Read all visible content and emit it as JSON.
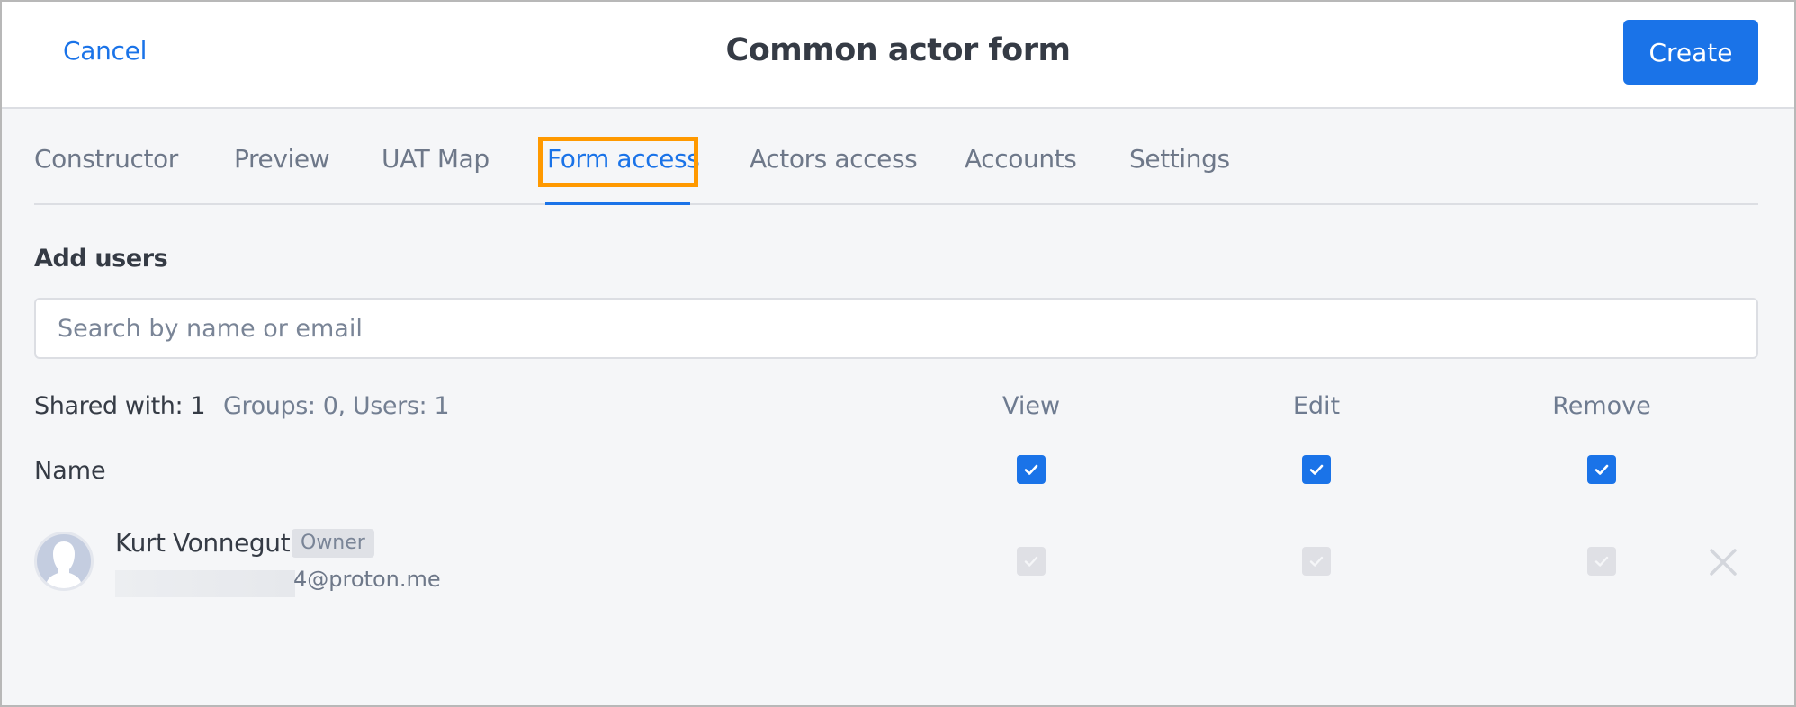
{
  "header": {
    "cancel_label": "Cancel",
    "title": "Common actor form",
    "create_label": "Create"
  },
  "tabs": [
    {
      "label": "Constructor",
      "active": false
    },
    {
      "label": "Preview",
      "active": false
    },
    {
      "label": "UAT Map",
      "active": false
    },
    {
      "label": "Form access",
      "active": true
    },
    {
      "label": "Actors access",
      "active": false
    },
    {
      "label": "Accounts",
      "active": false
    },
    {
      "label": "Settings",
      "active": false
    }
  ],
  "add_users": {
    "label": "Add users",
    "search_placeholder": "Search by name or email",
    "search_value": ""
  },
  "summary": {
    "shared_with": "Shared with: 1",
    "breakdown": "Groups: 0, Users: 1"
  },
  "columns": {
    "name": "Name",
    "view": "View",
    "edit": "Edit",
    "remove": "Remove"
  },
  "header_permissions": {
    "view": true,
    "edit": true,
    "remove": true
  },
  "users": [
    {
      "name": "Kurt Vonnegut",
      "badge": "Owner",
      "email_visible": "4@proton.me",
      "email_redacted": true,
      "permissions": {
        "view": true,
        "edit": true,
        "remove": true
      },
      "permissions_disabled": true,
      "avatar_icon": "default-user-silhouette-icon",
      "remove_icon": "close-icon"
    }
  ],
  "colors": {
    "accent": "#1a73e8",
    "focus_ring": "#ff9900",
    "text_primary": "#353b45",
    "text_secondary": "#6e7889",
    "disabled": "#dfe0e5"
  }
}
